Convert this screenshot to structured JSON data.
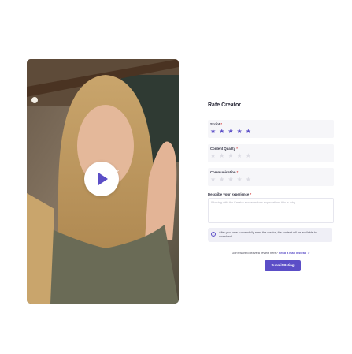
{
  "form": {
    "title": "Rate Creator",
    "required_mark": "*",
    "criteria": [
      {
        "label": "Script",
        "rating": 5,
        "max": 5
      },
      {
        "label": "Content Quality",
        "rating": 0,
        "max": 5
      },
      {
        "label": "Communication",
        "rating": 0,
        "max": 5
      }
    ],
    "description_label": "Describe your experience",
    "description_placeholder": "Working with the Creator exceeded our expectations this is why...",
    "info_text": "After you have successfully rated the creator, the content will be available to download.",
    "mail_prompt": "Don't want to leave a review here?",
    "mail_link": "Send a mail instead",
    "mail_arrow": "↗",
    "submit_label": "Submit Rating"
  },
  "video": {
    "play_icon": "play-icon"
  },
  "colors": {
    "accent": "#5b4ec7",
    "star_off": "#dcdce4",
    "info_bg": "#efeff6"
  }
}
